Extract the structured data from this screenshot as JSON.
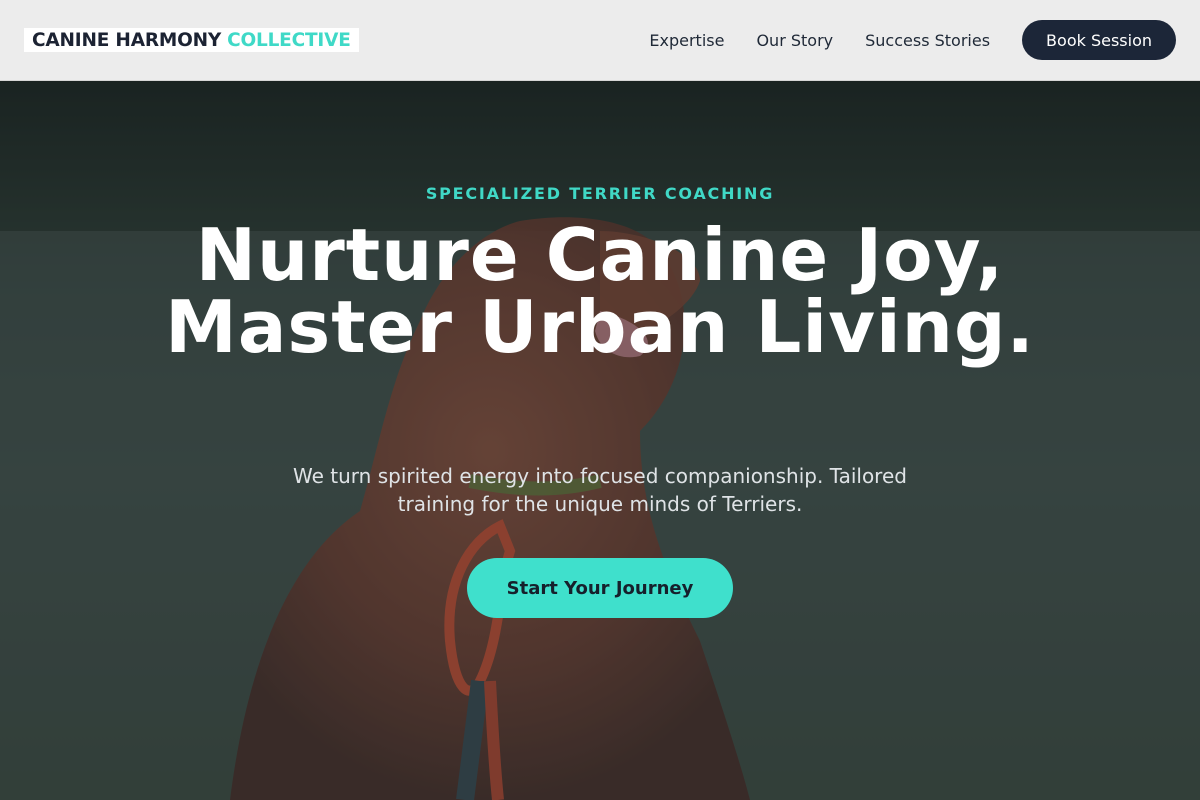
{
  "header": {
    "logo_main": "CANINE HARMONY",
    "logo_accent": "COLLECTIVE",
    "nav": [
      {
        "label": "Expertise"
      },
      {
        "label": "Our Story"
      },
      {
        "label": "Success Stories"
      }
    ],
    "book_label": "Book Session"
  },
  "hero": {
    "eyebrow": "SPECIALIZED TERRIER COACHING",
    "headline": "Nurture Canine Joy, Master Urban Living.",
    "subtext": "We turn spirited energy into focused companionship. Tailored training for the unique minds of Terriers.",
    "cta_label": "Start Your Journey",
    "background_image": "photo of a reddish-brown dog on grass wearing an orange carabiner leash"
  },
  "colors": {
    "accent": "#3fe0cc",
    "dark": "#1c2638",
    "header_bg": "#ececec"
  }
}
